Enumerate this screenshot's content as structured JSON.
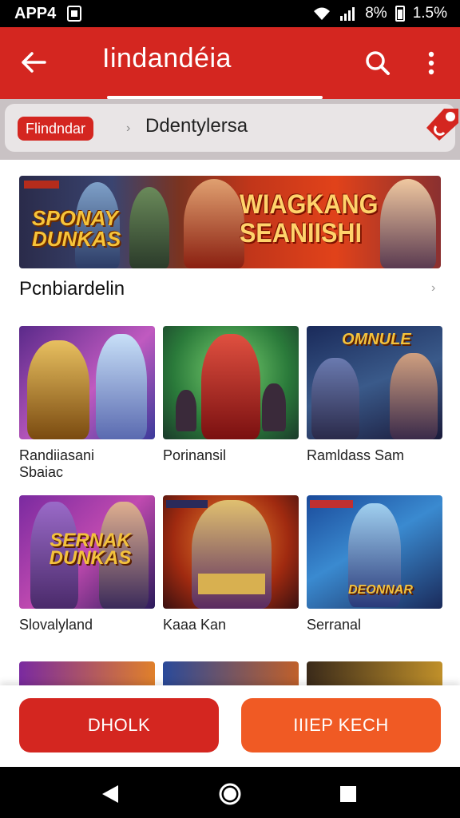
{
  "status_bar": {
    "left_text": "APP4",
    "battery_text": "1.5%",
    "signal_text": "8%"
  },
  "app_bar": {
    "title": "Iindandéia"
  },
  "search": {
    "filter_chip": "Flindndar",
    "query": "Ddentylersa"
  },
  "banner": {
    "left_title_line1": "SPONAY",
    "left_title_line2": "DUNKAS",
    "right_title_line1": "WIAGKANG",
    "right_title_line2": "SEANIISHI"
  },
  "section": {
    "heading": "Pcnbiardelin"
  },
  "games": [
    {
      "title": "Randiiasani\nSbaiac",
      "logo": ""
    },
    {
      "title": "Porinansil",
      "logo": ""
    },
    {
      "title": "Ramldass Sam",
      "logo": "OMNULE"
    },
    {
      "title": "Slovalyland",
      "logo": "SERNAK DUNKAS"
    },
    {
      "title": "Kaaa Kan",
      "logo": ""
    },
    {
      "title": "Serranal",
      "logo": "DEONNAR"
    }
  ],
  "buttons": {
    "primary": "DHOLK",
    "secondary": "IIIEP KECH"
  },
  "colors": {
    "brand_red": "#d42620",
    "accent_orange": "#f05a24"
  }
}
